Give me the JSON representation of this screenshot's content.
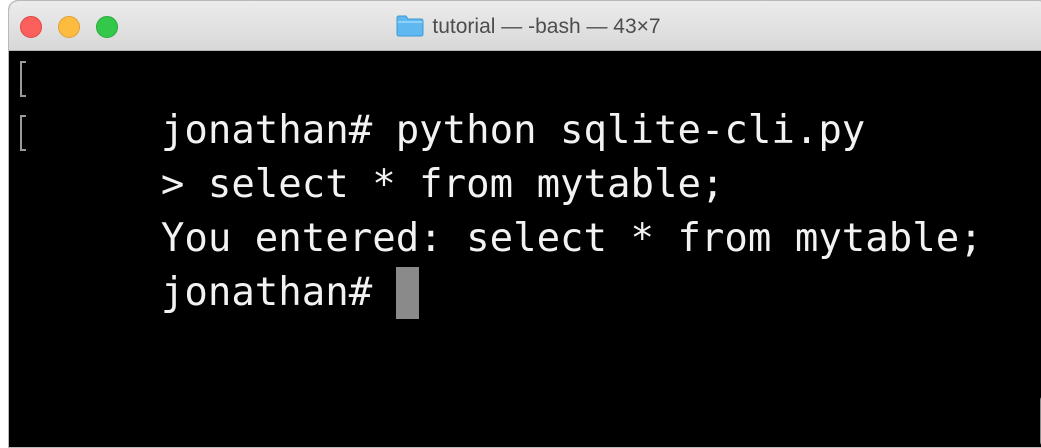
{
  "window": {
    "title": "tutorial — -bash — 43×7"
  },
  "terminal": {
    "lines": [
      {
        "text": "jonathan# python sqlite-cli.py",
        "mark": true
      },
      {
        "text": "> select * from mytable;",
        "mark": true
      },
      {
        "text": "You entered: select * from mytable;",
        "mark": false
      },
      {
        "text": "jonathan# ",
        "mark": false
      }
    ]
  },
  "colors": {
    "background": "#000000",
    "text": "#f2f2f2",
    "cursor": "#8a8a8a",
    "close": "#fc605c",
    "minimize": "#fdbc40",
    "zoom": "#34c84a",
    "folder": "#5fb8ef"
  },
  "icons": {
    "title": "folder-icon"
  }
}
